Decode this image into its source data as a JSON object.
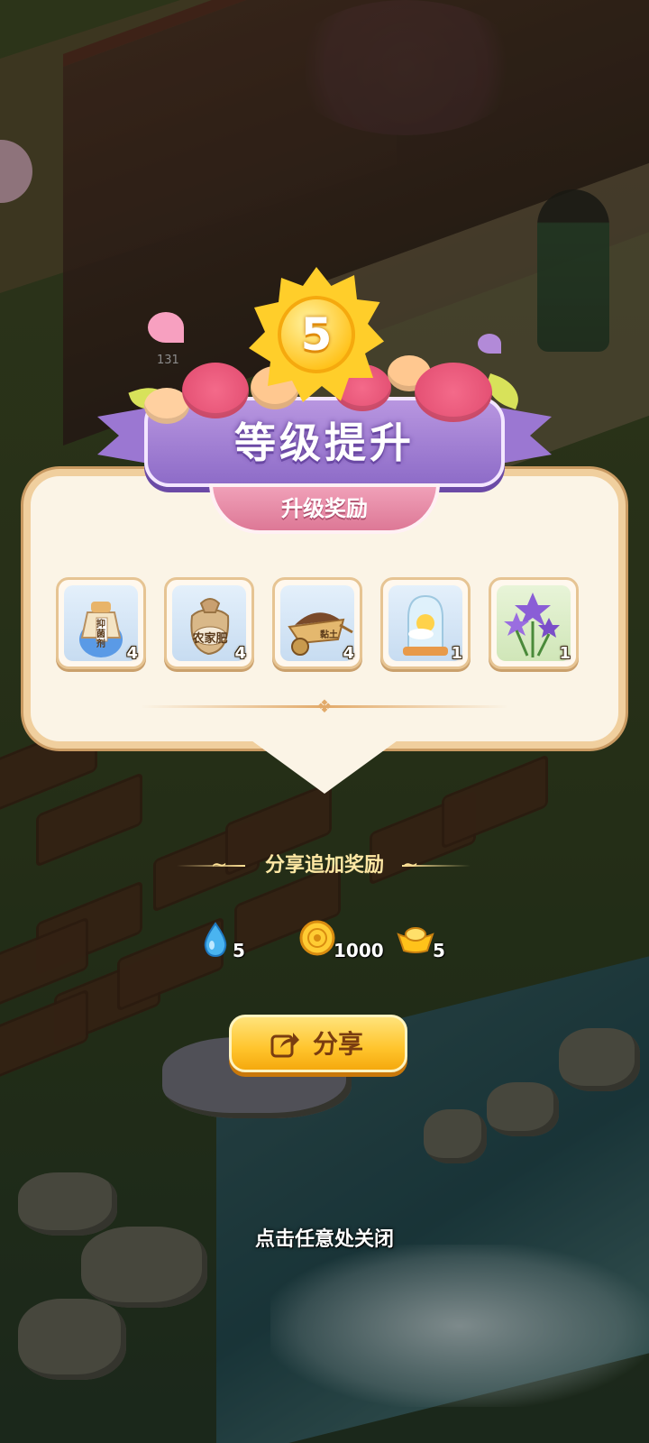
{
  "dialog": {
    "level": "5",
    "title": "等级提升",
    "subtitle": "升级奖励",
    "rewards": [
      {
        "name": "bactericide-bag",
        "label": "抑菌剂",
        "count": "4",
        "icon": "potion-bag-icon"
      },
      {
        "name": "fertilizer-bag",
        "label": "农家肥",
        "count": "4",
        "icon": "sack-icon"
      },
      {
        "name": "soil-cart",
        "label": "黏土",
        "count": "4",
        "icon": "wheelbarrow-icon"
      },
      {
        "name": "weather-globe",
        "label": "",
        "count": "1",
        "icon": "glass-dome-icon"
      },
      {
        "name": "bellflower",
        "label": "",
        "count": "1",
        "icon": "purple-flower-icon"
      }
    ]
  },
  "share": {
    "title": "分享追加奖励",
    "rewards": [
      {
        "icon": "water-drop-icon",
        "amount": "5"
      },
      {
        "icon": "coin-icon",
        "amount": "1000"
      },
      {
        "icon": "gold-ingot-icon",
        "amount": "5"
      }
    ],
    "button_label": "分享"
  },
  "close_hint": "点击任意处关闭",
  "scene": {
    "badge_count": "131"
  },
  "colors": {
    "banner": "#9b77d2",
    "panel": "#fbf4e6",
    "button": "#ffc42c",
    "subbanner": "#dd7896"
  }
}
